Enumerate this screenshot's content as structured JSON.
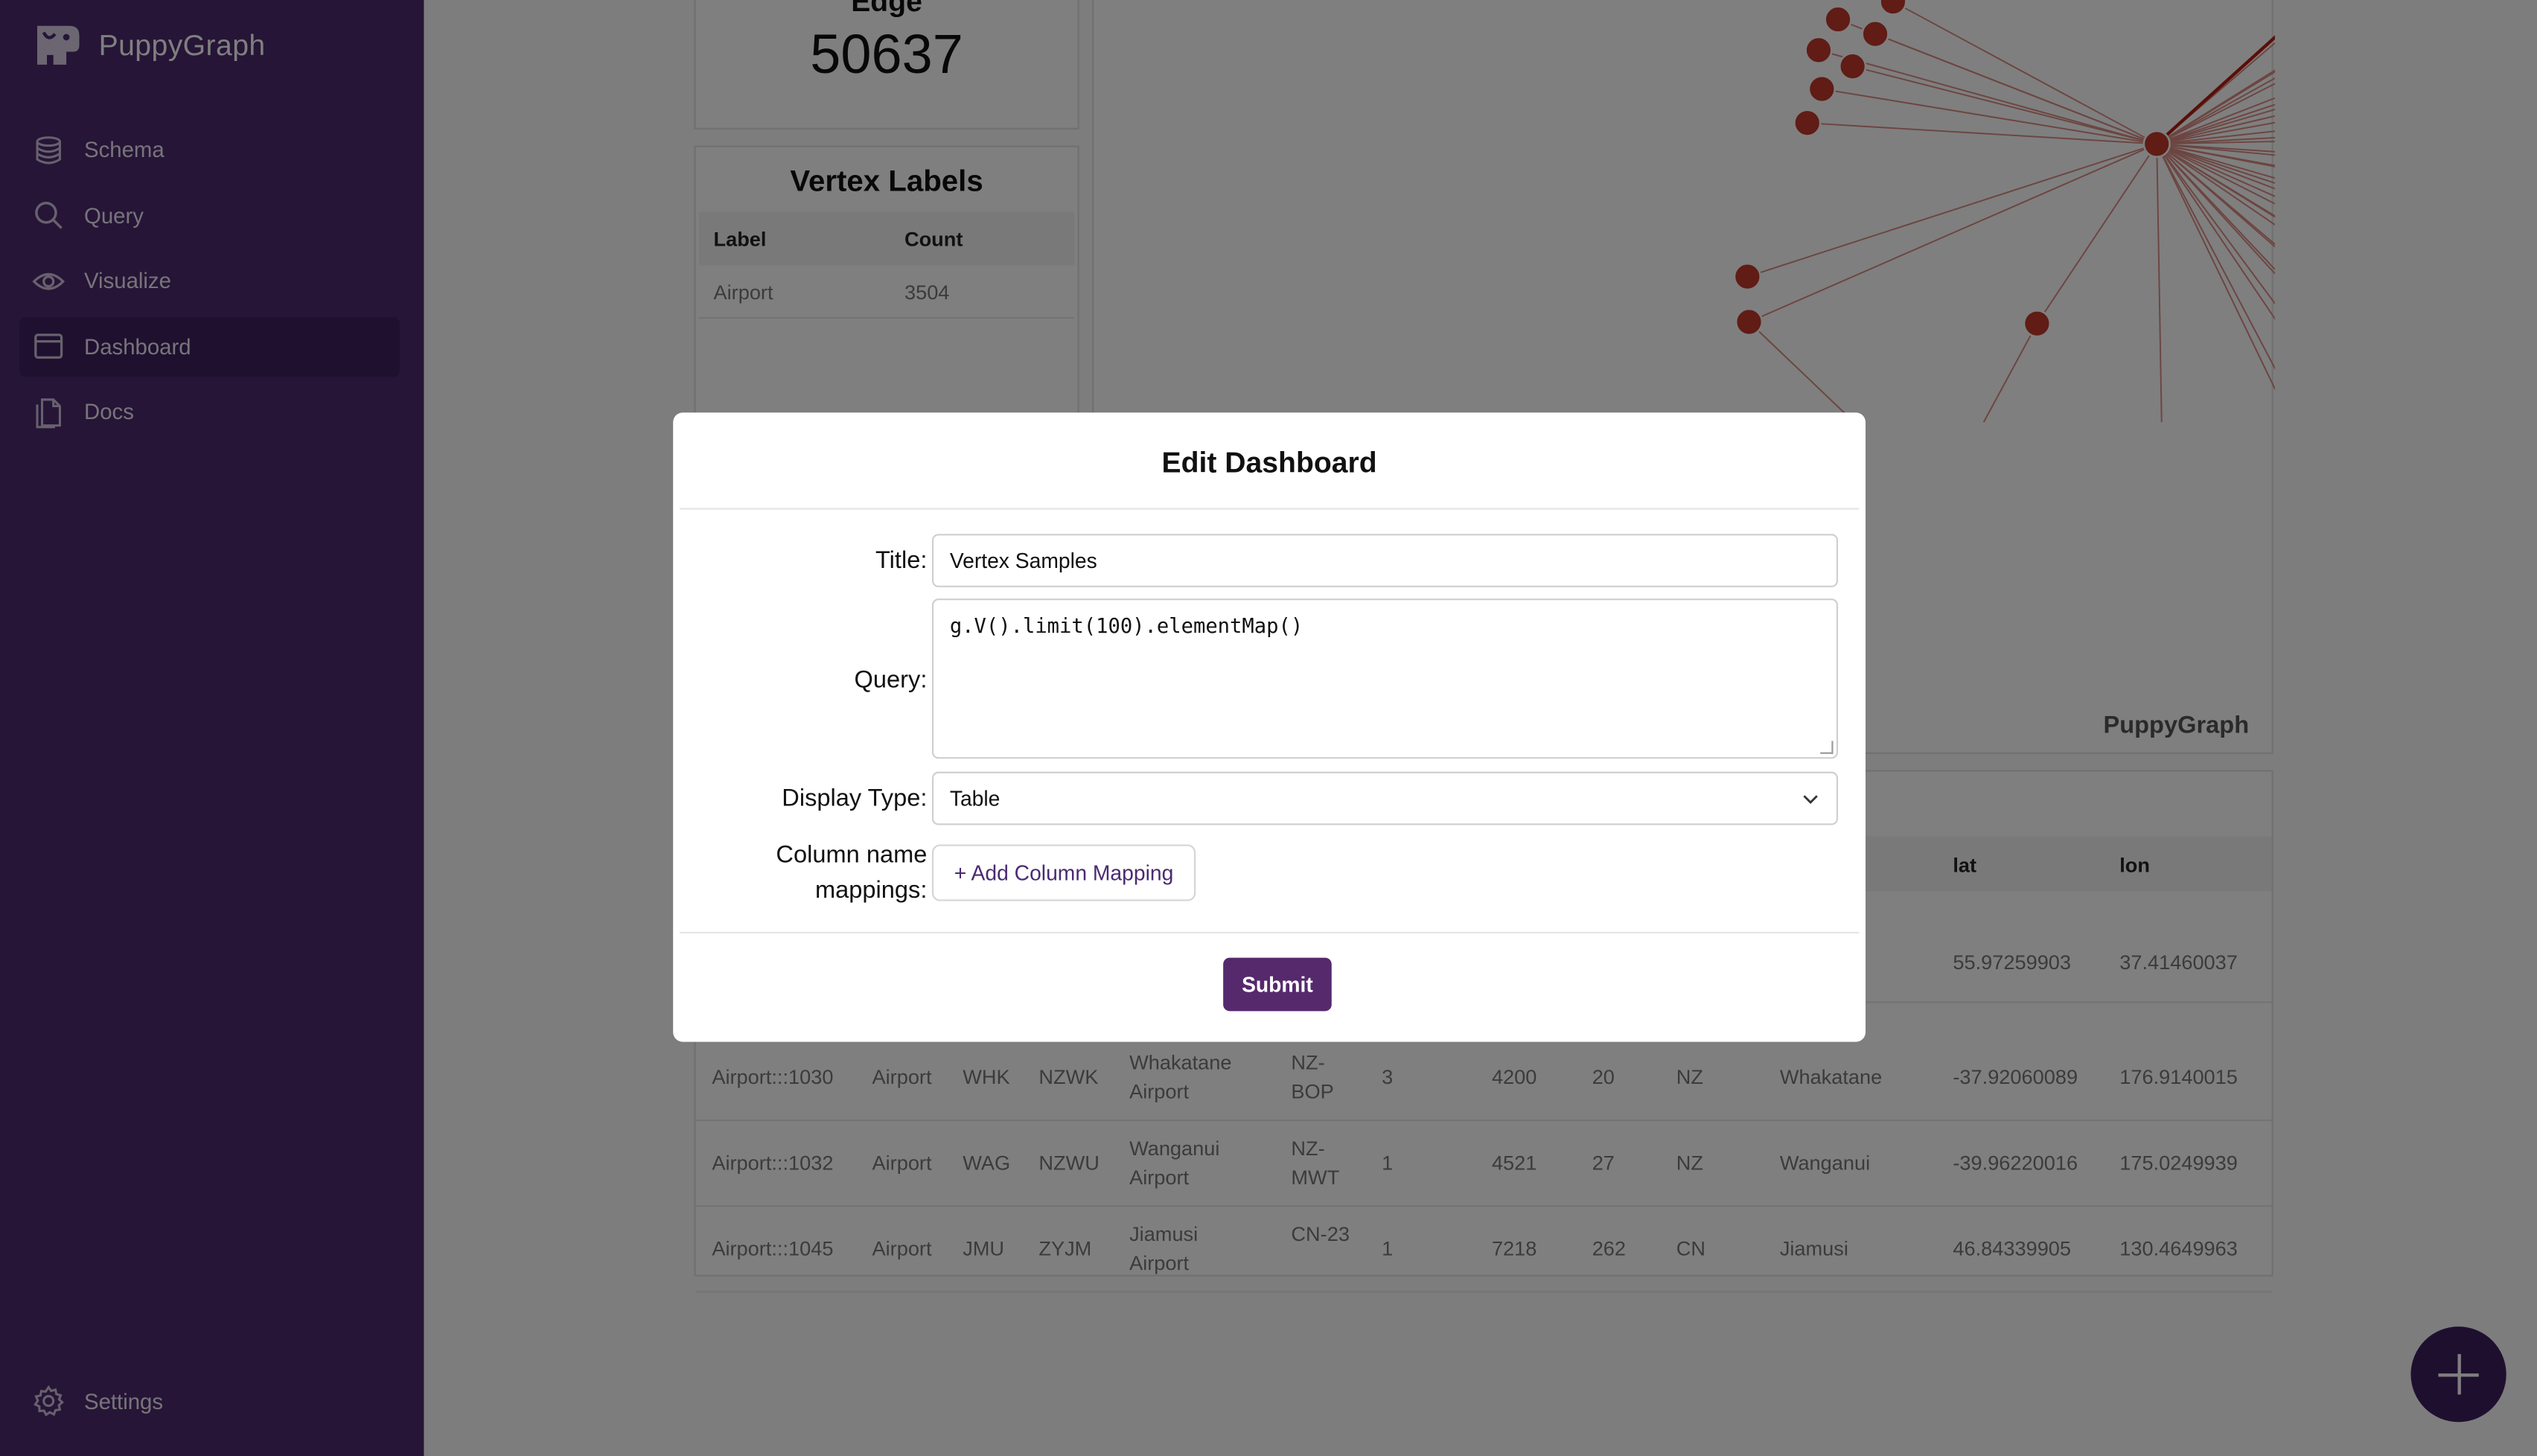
{
  "app": {
    "name": "PuppyGraph",
    "logo_icon": "puppy-logo-icon"
  },
  "sidebar": {
    "items": [
      {
        "label": "Schema",
        "icon": "database-icon",
        "active": false
      },
      {
        "label": "Query",
        "icon": "search-icon",
        "active": false
      },
      {
        "label": "Visualize",
        "icon": "eye-icon",
        "active": false
      },
      {
        "label": "Dashboard",
        "icon": "dashboard-icon",
        "active": true
      },
      {
        "label": "Docs",
        "icon": "docs-icon",
        "active": false
      }
    ],
    "settings_label": "Settings",
    "bg_color": "#4c2a6e"
  },
  "dashboard": {
    "edge_card": {
      "title": "Edge",
      "value": "50637"
    },
    "vertex_labels": {
      "title": "Vertex Labels",
      "columns": [
        "Label",
        "Count"
      ],
      "rows": [
        [
          "Airport",
          "3504"
        ]
      ]
    },
    "graph": {
      "watermark": "PuppyGraph",
      "node_color": "#c0392b"
    },
    "vertex_table": {
      "columns": [
        "lat",
        "lon"
      ],
      "partial_row": {
        "lat": "55.97259903",
        "lon": "37.41460037"
      },
      "rows": [
        [
          "Airport:::1030",
          "Airport",
          "WHK",
          "NZWK",
          "Whakatane Airport",
          "NZ-BOP",
          "3",
          "4200",
          "20",
          "NZ",
          "Whakatane",
          "-37.92060089",
          "176.9140015"
        ],
        [
          "Airport:::1032",
          "Airport",
          "WAG",
          "NZWU",
          "Wanganui Airport",
          "NZ-MWT",
          "1",
          "4521",
          "27",
          "NZ",
          "Wanganui",
          "-39.96220016",
          "175.0249939"
        ],
        [
          "Airport:::1045",
          "Airport",
          "JMU",
          "ZYJM",
          "Jiamusi Airport",
          "CN-23",
          "1",
          "7218",
          "262",
          "CN",
          "Jiamusi",
          "46.84339905",
          "130.4649963"
        ]
      ]
    },
    "fab_icon": "plus-icon"
  },
  "modal": {
    "title": "Edit Dashboard",
    "title_label": "Title:",
    "title_value": "Vertex Samples",
    "query_label": "Query:",
    "query_value": "g.V().limit(100).elementMap()",
    "display_type_label": "Display Type:",
    "display_type_value": "Table",
    "mapping_label_line1": "Column name",
    "mapping_label_line2": "mappings:",
    "add_mapping_label": "+ Add Column Mapping",
    "submit_label": "Submit",
    "accent_color": "#56296d"
  }
}
